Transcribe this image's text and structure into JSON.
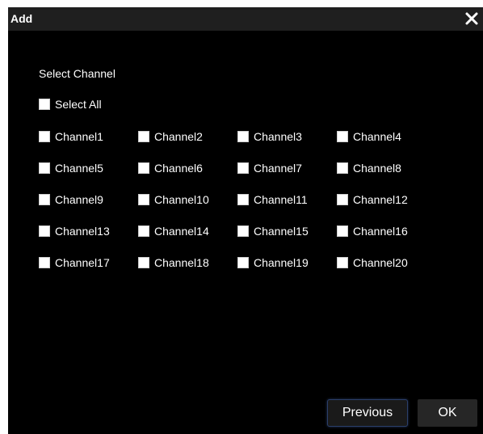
{
  "dialog": {
    "title": "Add",
    "close_icon": "close-icon",
    "section_label": "Select Channel",
    "select_all_label": "Select All",
    "select_all_checked": false,
    "channels": [
      {
        "label": "Channel1",
        "checked": false
      },
      {
        "label": "Channel2",
        "checked": false
      },
      {
        "label": "Channel3",
        "checked": false
      },
      {
        "label": "Channel4",
        "checked": false
      },
      {
        "label": "Channel5",
        "checked": false
      },
      {
        "label": "Channel6",
        "checked": false
      },
      {
        "label": "Channel7",
        "checked": false
      },
      {
        "label": "Channel8",
        "checked": false
      },
      {
        "label": "Channel9",
        "checked": false
      },
      {
        "label": "Channel10",
        "checked": false
      },
      {
        "label": "Channel11",
        "checked": false
      },
      {
        "label": "Channel12",
        "checked": false
      },
      {
        "label": "Channel13",
        "checked": false
      },
      {
        "label": "Channel14",
        "checked": false
      },
      {
        "label": "Channel15",
        "checked": false
      },
      {
        "label": "Channel16",
        "checked": false
      },
      {
        "label": "Channel17",
        "checked": false
      },
      {
        "label": "Channel18",
        "checked": false
      },
      {
        "label": "Channel19",
        "checked": false
      },
      {
        "label": "Channel20",
        "checked": false
      }
    ],
    "buttons": {
      "previous_label": "Previous",
      "ok_label": "OK"
    }
  },
  "colors": {
    "background": "#000000",
    "titlebar": "#1f1f1f",
    "text": "#ffffff",
    "previous_border": "#2b3f6b"
  }
}
